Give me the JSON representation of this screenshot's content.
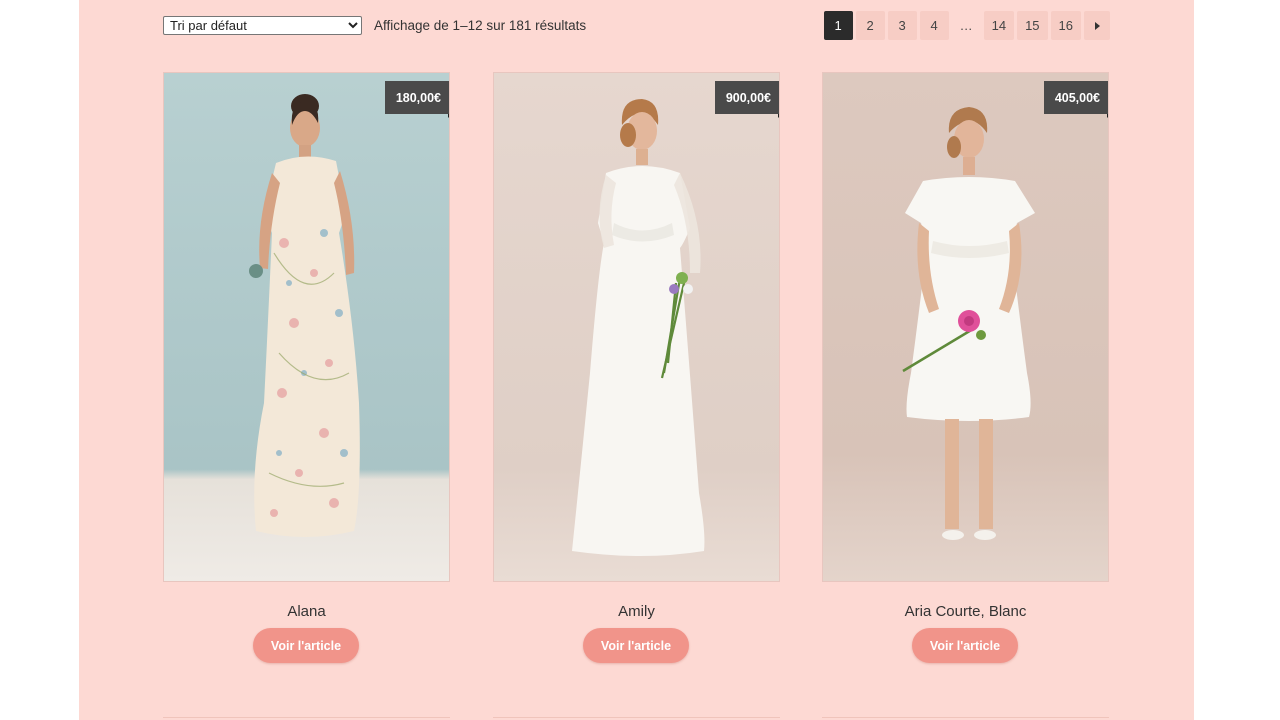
{
  "shop": {
    "sort": {
      "selected": "Tri par défaut"
    },
    "result_count": "Affichage de 1–12 sur 181 résultats",
    "pagination": {
      "pages": [
        "1",
        "2",
        "3",
        "4",
        "…",
        "14",
        "15",
        "16"
      ],
      "current": "1",
      "next_icon": "chevron-right-icon"
    }
  },
  "products": [
    {
      "title": "Alana",
      "price": "180,00€",
      "button_label": "Voir l'article"
    },
    {
      "title": "Amily",
      "price": "900,00€",
      "button_label": "Voir l'article"
    },
    {
      "title": "Aria Courte, Blanc",
      "price": "405,00€",
      "button_label": "Voir l'article"
    }
  ],
  "colors": {
    "page_background": "#fdd9d3",
    "button": "#f1948a",
    "price_tag": "#4a4a4a",
    "current_page": "#2b2b2b"
  }
}
